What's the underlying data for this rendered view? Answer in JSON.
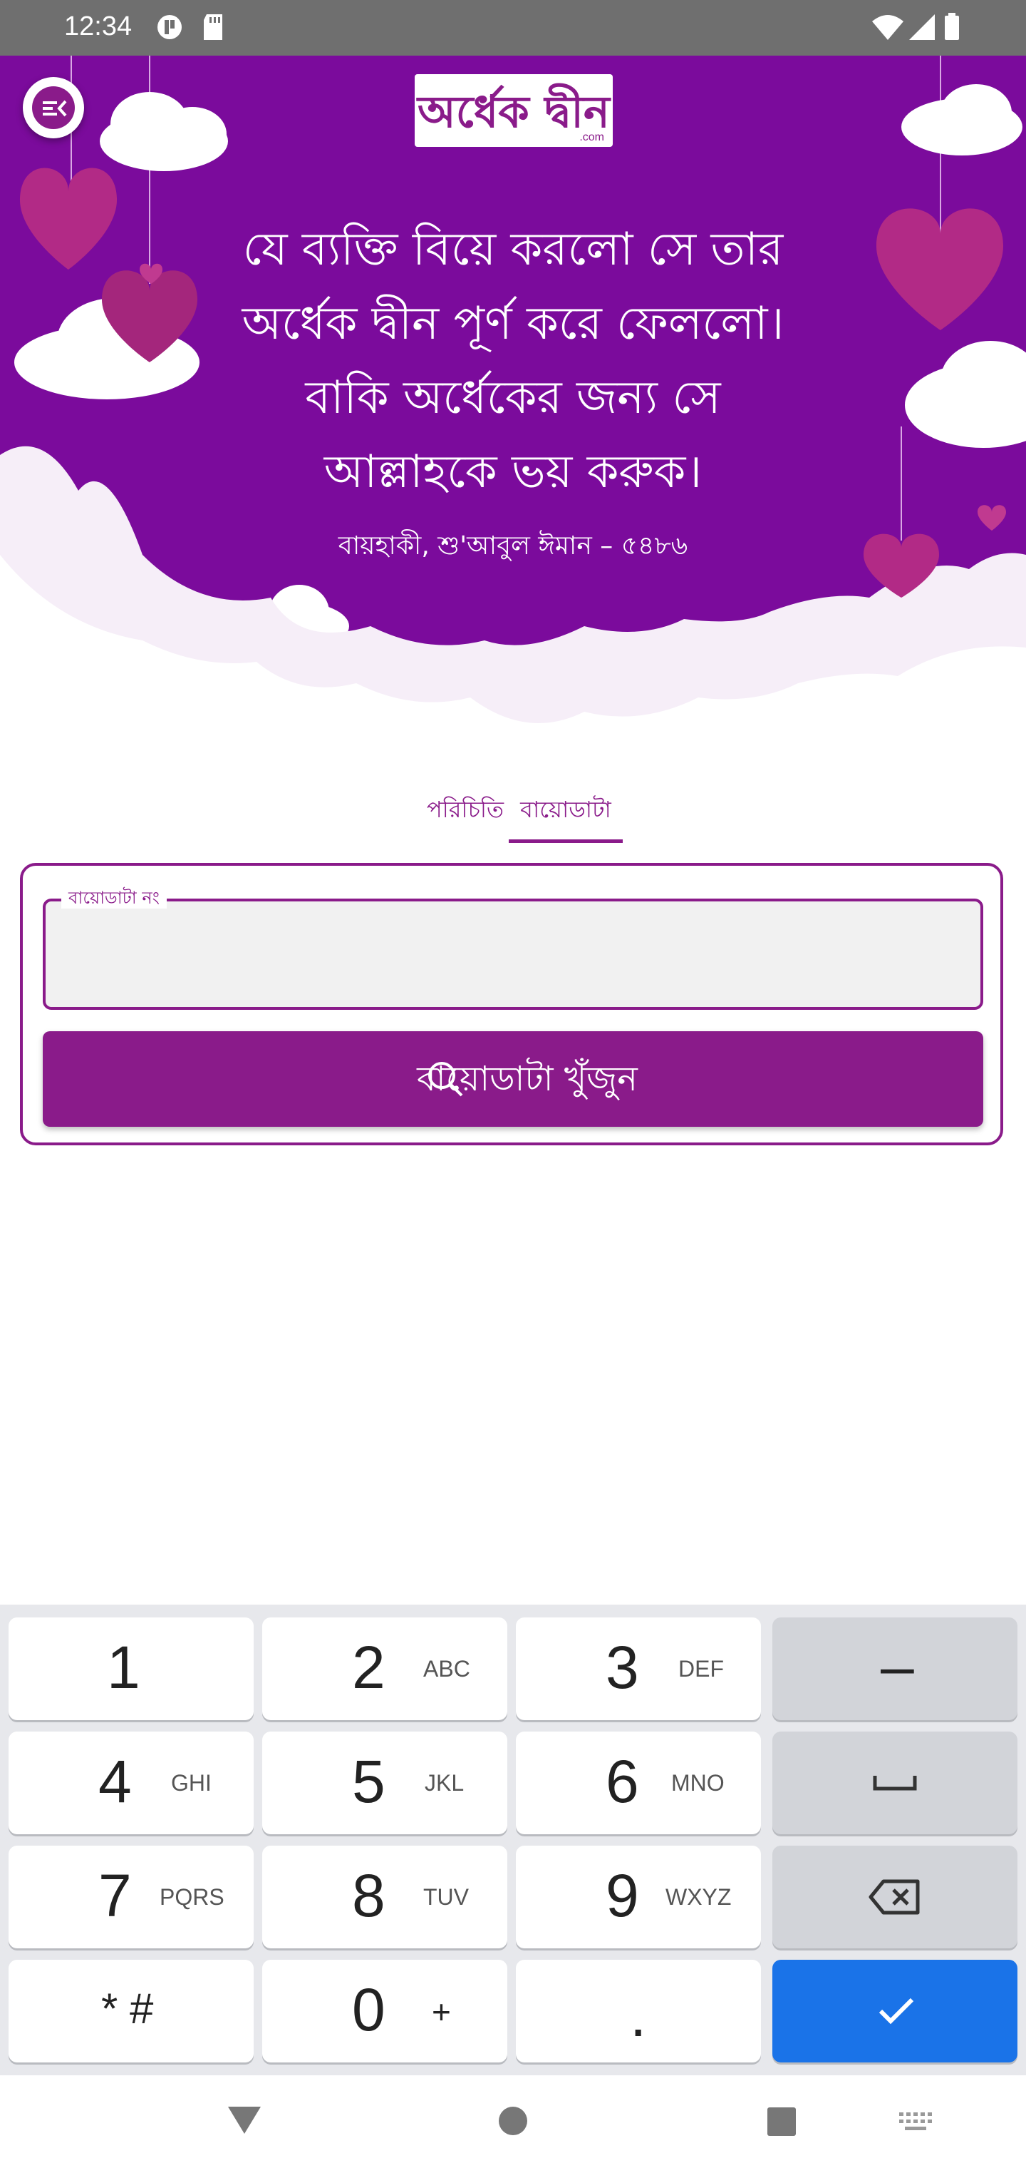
{
  "status_bar": {
    "time": "12:34",
    "icons": [
      "app-notification-icon",
      "sd-card-icon",
      "wifi-icon",
      "signal-icon",
      "battery-icon"
    ]
  },
  "header": {
    "logo_text": "অর্ধেক দ্বীন",
    "logo_sub": ".com",
    "menu_icon": "menu-open-icon"
  },
  "quote": {
    "lines": [
      "যে ব্যক্তি বিয়ে করলো সে তার",
      "অর্ধেক দ্বীন পূর্ণ করে ফেললো।",
      "বাকি অর্ধেকের জন্য সে",
      "আল্লাহকে ভয় করুক।"
    ],
    "source": "বায়হাকী, শু'আবুল ঈমান – ৫৪৮৬"
  },
  "tabs": [
    {
      "label": "পরিচিতি",
      "active": false
    },
    {
      "label": "বায়োডাটা",
      "active": true
    }
  ],
  "form": {
    "field_label": "বায়োডাটা নং",
    "field_value": "",
    "search_button_label": "বায়োডাটা খুঁজুন"
  },
  "keyboard": {
    "rows": [
      [
        {
          "num": "1",
          "letters": ""
        },
        {
          "num": "2",
          "letters": "ABC"
        },
        {
          "num": "3",
          "letters": "DEF"
        },
        {
          "num": "–",
          "letters": ""
        }
      ],
      [
        {
          "num": "4",
          "letters": "GHI"
        },
        {
          "num": "5",
          "letters": "JKL"
        },
        {
          "num": "6",
          "letters": "MNO"
        },
        {
          "num": "",
          "letters": ""
        }
      ],
      [
        {
          "num": "7",
          "letters": "PQRS"
        },
        {
          "num": "8",
          "letters": "TUV"
        },
        {
          "num": "9",
          "letters": "WXYZ"
        },
        {
          "num": "",
          "letters": ""
        }
      ],
      [
        {
          "num": "* #",
          "letters": ""
        },
        {
          "num": "0",
          "letters": "+"
        },
        {
          "num": ".",
          "letters": ""
        },
        {
          "num": "",
          "letters": ""
        }
      ]
    ],
    "special_icons": [
      "space-icon",
      "backspace-icon",
      "checkmark-icon"
    ]
  },
  "colors": {
    "brand": "#8a1b8a",
    "hero_bg": "#7b0b9c",
    "keyboard_bg": "#e7e8ec",
    "enter_key": "#1a73e8"
  },
  "nav_bar": {
    "icons": [
      "back-icon",
      "home-icon",
      "recents-icon",
      "keyboard-switch-icon"
    ]
  }
}
